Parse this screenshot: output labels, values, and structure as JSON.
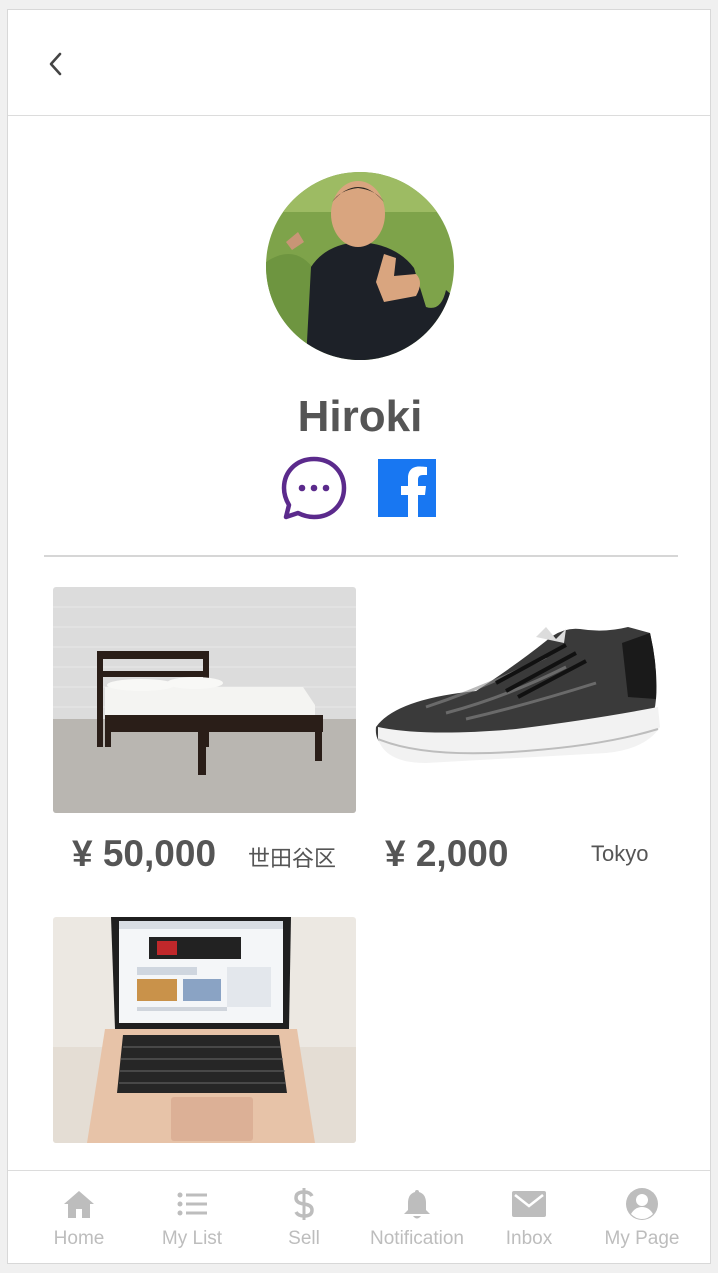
{
  "header": {
    "back_icon": "chevron-left-icon"
  },
  "profile": {
    "name": "Hiroki",
    "message_icon": "chat-bubble-icon",
    "facebook_icon": "facebook-icon",
    "colors": {
      "message": "#5b2a8c",
      "facebook": "#1877f2"
    }
  },
  "listings": [
    {
      "image": "bed-photo",
      "price": "¥ 50,000",
      "location": "世田谷区"
    },
    {
      "image": "sneaker-photo",
      "price": "¥ 2,000",
      "location": "Tokyo"
    },
    {
      "image": "laptop-photo",
      "price": "",
      "location": ""
    }
  ],
  "tabbar": {
    "tabs": [
      {
        "label": "Home",
        "icon": "home-icon"
      },
      {
        "label": "My List",
        "icon": "list-icon"
      },
      {
        "label": "Sell",
        "icon": "dollar-icon"
      },
      {
        "label": "Notification",
        "icon": "bell-icon"
      },
      {
        "label": "Inbox",
        "icon": "mail-icon"
      },
      {
        "label": "My Page",
        "icon": "user-circle-icon"
      }
    ]
  }
}
